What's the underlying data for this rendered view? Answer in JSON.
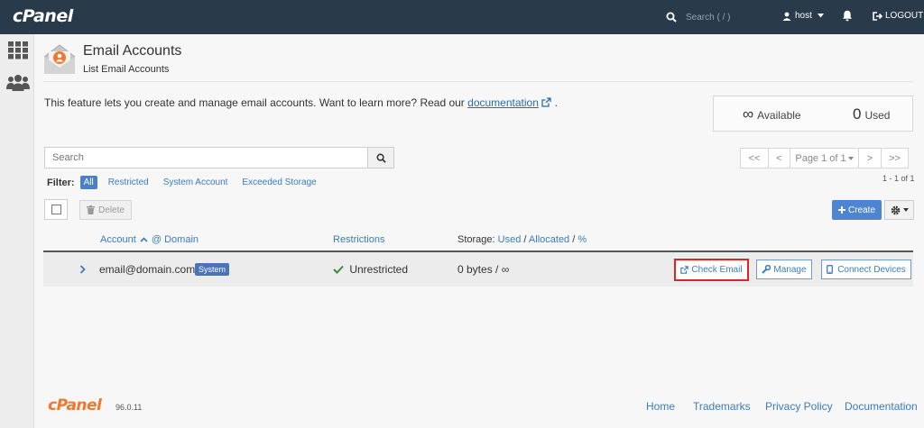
{
  "topbar": {
    "brand": "cPanel",
    "search_placeholder": "Search ( / )",
    "user": "host",
    "logout": "LOGOUT"
  },
  "header": {
    "title": "Email Accounts",
    "subtitle": "List Email Accounts"
  },
  "intro": {
    "text_before": "This feature lets you create and manage email accounts. Want to learn more? Read our ",
    "link": "documentation",
    "text_after": "."
  },
  "stats": {
    "available_value": "∞",
    "available_label": "Available",
    "used_value": "0",
    "used_label": "Used"
  },
  "search": {
    "placeholder": "Search"
  },
  "pager": {
    "first": "<<",
    "prev": "<",
    "page": "Page 1 of 1",
    "next": ">",
    "last": ">>",
    "range": "1 - 1 of 1"
  },
  "filter": {
    "label": "Filter:",
    "options": [
      "All",
      "Restricted",
      "System Account",
      "Exceeded Storage"
    ],
    "active": "All"
  },
  "toolbar": {
    "delete": "Delete",
    "create": "Create"
  },
  "table": {
    "col_account": "Account",
    "col_at_domain": "@ Domain",
    "col_restrictions": "Restrictions",
    "col_storage": "Storage:",
    "col_used": "Used",
    "col_allocated": "Allocated",
    "col_percent": "%",
    "rows": [
      {
        "email": "email@domain.com",
        "badge": "System",
        "restriction": "Unrestricted",
        "storage": "0 bytes / ∞",
        "actions": [
          "Check Email",
          "Manage",
          "Connect Devices"
        ]
      }
    ]
  },
  "footer": {
    "logo": "cPanel",
    "version": "96.0.11",
    "links": [
      "Home",
      "Trademarks",
      "Privacy Policy",
      "Documentation"
    ]
  },
  "colors": {
    "topbar": "#293a4a",
    "accent": "#4d85d1",
    "link": "#3a7cbf",
    "highlight": "#e32222",
    "brand_orange": "#f0782e"
  }
}
